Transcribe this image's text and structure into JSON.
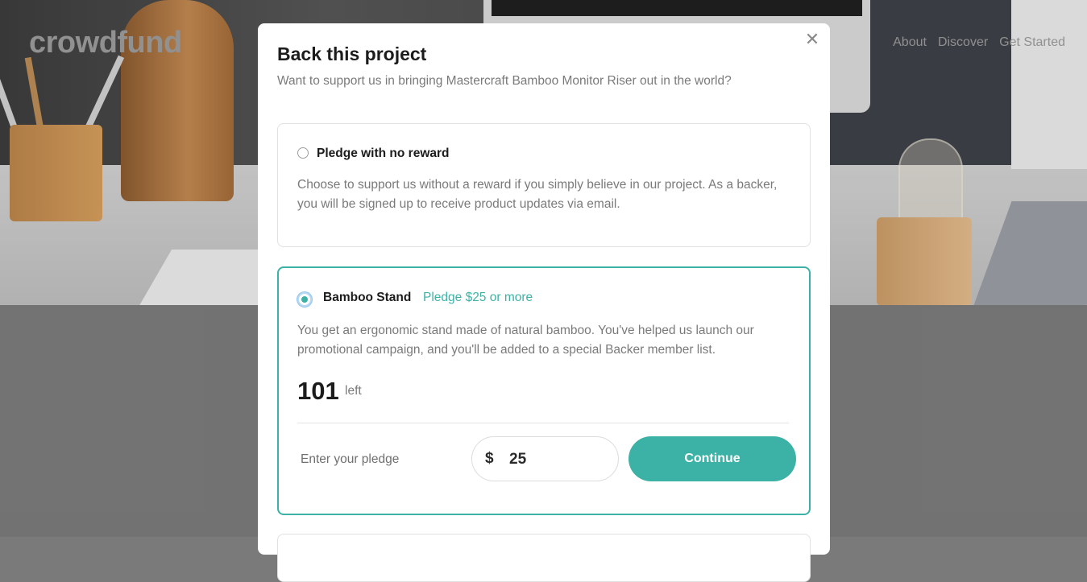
{
  "app": {
    "logo": "crowdfund"
  },
  "nav": {
    "items": [
      "About",
      "Discover",
      "Get Started"
    ]
  },
  "modal": {
    "title": "Back this project",
    "subtitle": "Want to support us in bringing Mastercraft Bamboo Monitor Riser out in the world?",
    "close_icon": "close-icon",
    "options": [
      {
        "title": "Pledge with no reward",
        "description": "Choose to support us without a reward if you simply believe in our project. As a backer, you will be signed up to receive product updates via email.",
        "selected": false
      },
      {
        "title": "Bamboo Stand",
        "pledge_text": "Pledge $25 or more",
        "description": "You get an ergonomic stand made of natural bamboo. You've helped us launch our promotional campaign, and you'll be added to a special Backer member list.",
        "count": "101",
        "count_label": "left",
        "selected": true,
        "enter_label": "Enter your pledge",
        "currency": "$",
        "amount": "25",
        "continue_label": "Continue"
      }
    ]
  },
  "colors": {
    "accent": "#3cb2a6",
    "text_dark": "#1c1c1c",
    "text_muted": "#7a7a7a"
  }
}
